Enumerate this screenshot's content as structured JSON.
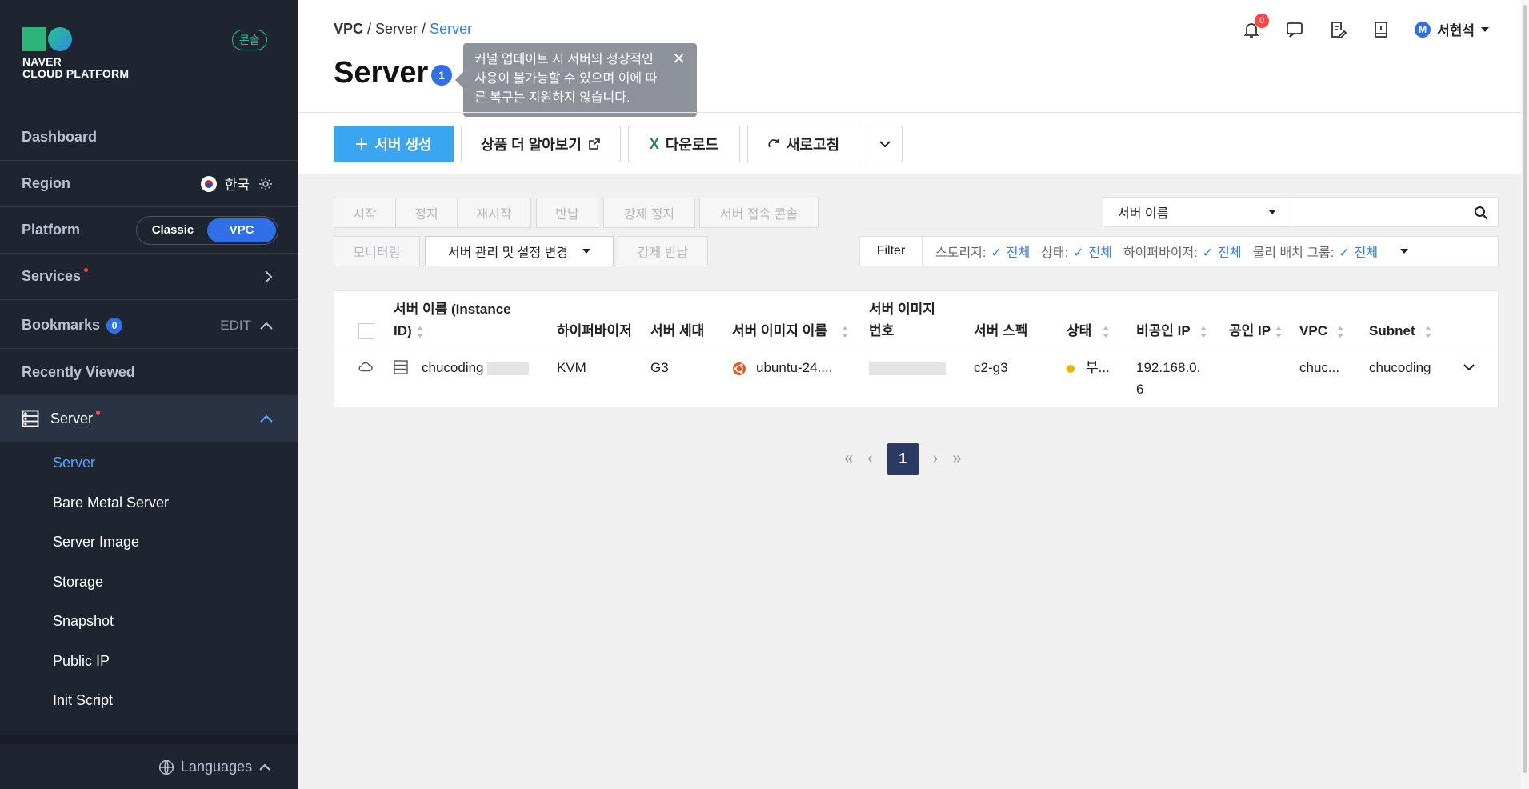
{
  "sidebar": {
    "logo_line1": "NAVER",
    "logo_line2": "CLOUD PLATFORM",
    "console_badge": "콘솔",
    "dashboard": "Dashboard",
    "region_label": "Region",
    "region_value": "한국",
    "platform_label": "Platform",
    "platform_classic": "Classic",
    "platform_vpc": "VPC",
    "services": "Services",
    "bookmarks": "Bookmarks",
    "bookmarks_count": "0",
    "bookmarks_edit": "EDIT",
    "recently_viewed": "Recently Viewed",
    "server_group": "Server",
    "sub_items": [
      "Server",
      "Bare Metal Server",
      "Server Image",
      "Storage",
      "Snapshot",
      "Public IP",
      "Init Script"
    ],
    "languages": "Languages"
  },
  "header": {
    "crumbs": [
      "VPC",
      "Server",
      "Server"
    ],
    "title": "Server",
    "info_count": "1",
    "tooltip_text": "커널 업데이트 시 서버의 정상적인 사용이 불가능할 수 있으며 이에 따른 복구는 지원하지 않습니다.",
    "notif_count": "0",
    "user_initial": "M",
    "user_name": "서현석"
  },
  "toolbar": {
    "create": "서버 생성",
    "learn_more": "상품 더 알아보기",
    "download": "다운로드",
    "refresh": "새로고침"
  },
  "actions": {
    "start": "시작",
    "stop": "정지",
    "restart": "재시작",
    "return": "반납",
    "force_stop": "강제 정지",
    "console": "서버 접속 콘솔",
    "monitoring": "모니터링",
    "manage": "서버 관리 및 설정 변경",
    "force_return": "강제 반납"
  },
  "search": {
    "select_value": "서버 이름"
  },
  "filter": {
    "label": "Filter",
    "storage_label": "스토리지:",
    "storage_value": "전체",
    "status_label": "상태:",
    "status_value": "전체",
    "hypervisor_label": "하이퍼바이저:",
    "hypervisor_value": "전체",
    "placement_label": "물리 배치 그룹:",
    "placement_value": "전체"
  },
  "table": {
    "headers": {
      "name_l1": "서버 이름 (Instance",
      "name_l2": "ID)",
      "hypervisor": "하이퍼바이저",
      "generation": "서버 세대",
      "image_name": "서버 이미지 이름",
      "image_no_l1": "서버 이미지",
      "image_no_l2": "번호",
      "spec": "서버 스펙",
      "status": "상태",
      "private_ip": "비공인 IP",
      "public_ip": "공인 IP",
      "vpc": "VPC",
      "subnet": "Subnet"
    },
    "row": {
      "name": "chucoding",
      "hypervisor": "KVM",
      "generation": "G3",
      "image_name": "ubuntu-24....",
      "spec": "c2-g3",
      "status": "부...",
      "private_ip_l1": "192.168.0.",
      "private_ip_l2": "6",
      "vpc": "chuc...",
      "subnet": "chucoding"
    }
  },
  "pagination": {
    "current": "1"
  },
  "colors": {
    "sidebar_bg": "#1e2430",
    "accent": "#2f6fe8",
    "primary_button": "#3aa6f2",
    "link": "#2f80ed",
    "status_dot": "#e6b400"
  }
}
